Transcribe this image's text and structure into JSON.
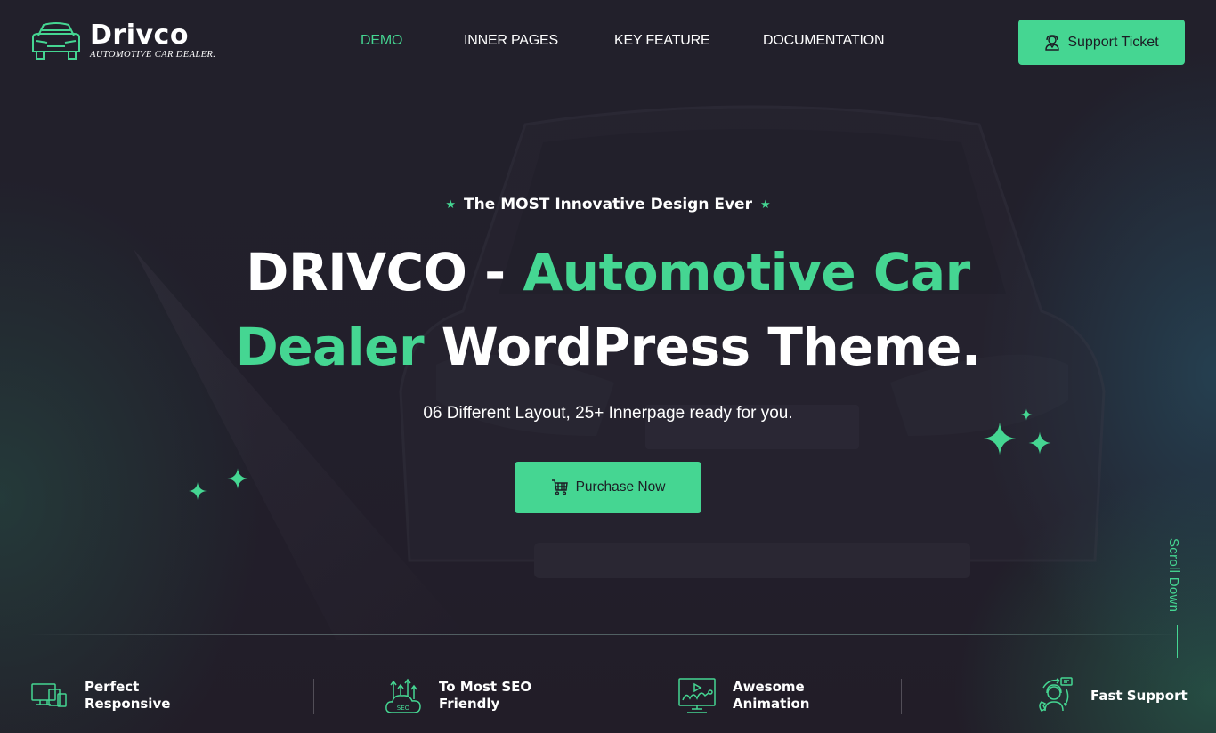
{
  "brand": {
    "name": "Drivco",
    "tagline": "AUTOMOTIVE CAR DEALER."
  },
  "nav": {
    "items": [
      {
        "label": "DEMO",
        "active": true
      },
      {
        "label": "INNER PAGES",
        "active": false
      },
      {
        "label": "KEY FEATURE",
        "active": false
      },
      {
        "label": "DOCUMENTATION",
        "active": false
      }
    ]
  },
  "header": {
    "support_label": "Support Ticket",
    "support_icon": "support-agent-icon"
  },
  "hero": {
    "tagline": "The MOST Innovative Design Ever",
    "tagline_icon": "star-icon",
    "title": {
      "line1_white": "DRIVCO - ",
      "line1_accent": "Automotive Car",
      "line2_accent": "Dealer",
      "line2_white": " WordPress Theme."
    },
    "subtitle": "06 Different Layout, 25+ Innerpage ready for you.",
    "purchase_label": "Purchase Now",
    "purchase_icon": "cart-icon",
    "scroll_label": "Scroll Down"
  },
  "features": [
    {
      "icon": "responsive-devices-icon",
      "line1": "Perfect",
      "line2": "Responsive"
    },
    {
      "icon": "seo-cloud-icon",
      "line1": "To Most SEO",
      "line2": "Friendly"
    },
    {
      "icon": "animation-monitor-icon",
      "line1": "Awesome",
      "line2": "Animation"
    },
    {
      "icon": "fast-support-icon",
      "line1": "Fast Support",
      "line2": ""
    }
  ],
  "colors": {
    "accent": "#45d692",
    "background": "#211f2a",
    "text": "#ffffff"
  }
}
